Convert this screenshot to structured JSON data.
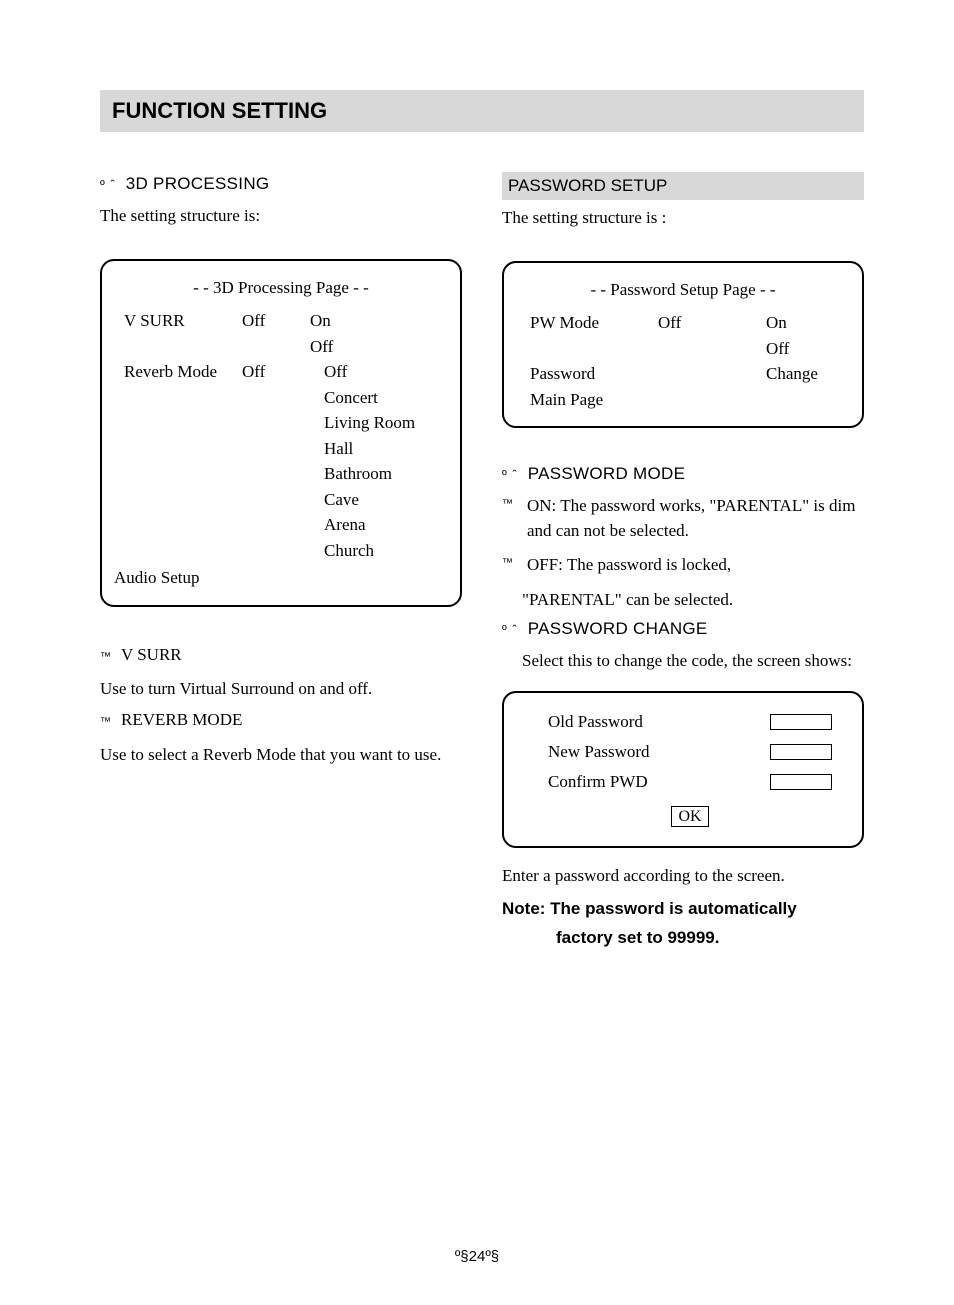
{
  "title": "FUNCTION SETTING",
  "left": {
    "bullet": "º ˆ",
    "heading": "3D PROCESSING",
    "intro": "The setting structure is:",
    "panel": {
      "title": "- - 3D Processing Page - -",
      "vsurr_label": "V SURR",
      "vsurr_current": "Off",
      "vsurr_opts": [
        "On",
        "Off"
      ],
      "reverb_label": "Reverb Mode",
      "reverb_current": "Off",
      "reverb_opts": [
        "Off",
        "Concert",
        "Living Room",
        "Hall",
        "Bathroom",
        "Cave",
        "Arena",
        "Church"
      ],
      "footer": "Audio Setup"
    },
    "sub_bullet": "™",
    "vsurr_head": "V SURR",
    "vsurr_desc": "Use to turn Virtual Surround on and off.",
    "reverb_head": "REVERB MODE",
    "reverb_desc": "Use to select a Reverb Mode that you want to use."
  },
  "right": {
    "heading_bar": "PASSWORD SETUP",
    "intro": "The setting structure is :",
    "panel1": {
      "title": "- - Password Setup Page - -",
      "pwmode_label": "PW Mode",
      "pwmode_current": "Off",
      "pwmode_opts": [
        "On",
        "Off"
      ],
      "password_label": "Password",
      "password_value": "Change",
      "mainpage_label": "Main Page"
    },
    "bullet": "º ˆ",
    "sub_bullet": "™",
    "pwmode_head": "PASSWORD MODE",
    "pwmode_on": "ON: The password works, \"PARENTAL\" is dim and can not be selected.",
    "pwmode_off1": "OFF: The password is locked,",
    "pwmode_off2": "\"PARENTAL\" can be selected.",
    "pwchange_head": "PASSWORD CHANGE",
    "pwchange_desc": "Select this to change the code, the screen shows:",
    "panel2": {
      "old": "Old Password",
      "new": "New Password",
      "confirm": "Confirm PWD",
      "ok": "OK"
    },
    "enter_text": "Enter a password according to the screen.",
    "note1": "Note: The password is automatically",
    "note2": "factory set to 99999."
  },
  "footer": "º§24º§"
}
